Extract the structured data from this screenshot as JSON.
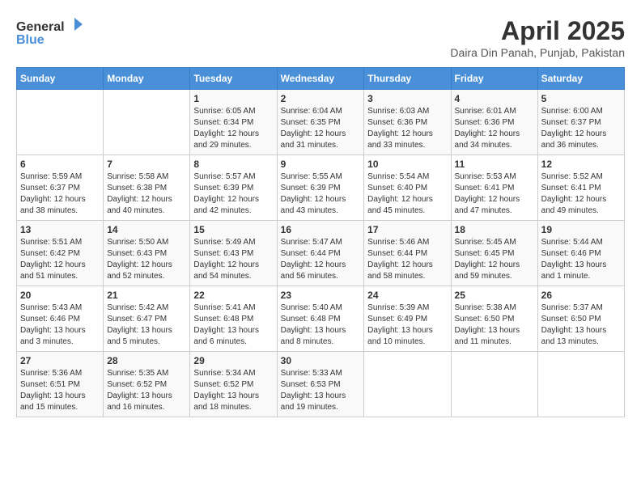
{
  "logo": {
    "general": "General",
    "blue": "Blue"
  },
  "title": "April 2025",
  "subtitle": "Daira Din Panah, Punjab, Pakistan",
  "days_of_week": [
    "Sunday",
    "Monday",
    "Tuesday",
    "Wednesday",
    "Thursday",
    "Friday",
    "Saturday"
  ],
  "weeks": [
    [
      {
        "day": "",
        "info": ""
      },
      {
        "day": "",
        "info": ""
      },
      {
        "day": "1",
        "info": "Sunrise: 6:05 AM\nSunset: 6:34 PM\nDaylight: 12 hours and 29 minutes."
      },
      {
        "day": "2",
        "info": "Sunrise: 6:04 AM\nSunset: 6:35 PM\nDaylight: 12 hours and 31 minutes."
      },
      {
        "day": "3",
        "info": "Sunrise: 6:03 AM\nSunset: 6:36 PM\nDaylight: 12 hours and 33 minutes."
      },
      {
        "day": "4",
        "info": "Sunrise: 6:01 AM\nSunset: 6:36 PM\nDaylight: 12 hours and 34 minutes."
      },
      {
        "day": "5",
        "info": "Sunrise: 6:00 AM\nSunset: 6:37 PM\nDaylight: 12 hours and 36 minutes."
      }
    ],
    [
      {
        "day": "6",
        "info": "Sunrise: 5:59 AM\nSunset: 6:37 PM\nDaylight: 12 hours and 38 minutes."
      },
      {
        "day": "7",
        "info": "Sunrise: 5:58 AM\nSunset: 6:38 PM\nDaylight: 12 hours and 40 minutes."
      },
      {
        "day": "8",
        "info": "Sunrise: 5:57 AM\nSunset: 6:39 PM\nDaylight: 12 hours and 42 minutes."
      },
      {
        "day": "9",
        "info": "Sunrise: 5:55 AM\nSunset: 6:39 PM\nDaylight: 12 hours and 43 minutes."
      },
      {
        "day": "10",
        "info": "Sunrise: 5:54 AM\nSunset: 6:40 PM\nDaylight: 12 hours and 45 minutes."
      },
      {
        "day": "11",
        "info": "Sunrise: 5:53 AM\nSunset: 6:41 PM\nDaylight: 12 hours and 47 minutes."
      },
      {
        "day": "12",
        "info": "Sunrise: 5:52 AM\nSunset: 6:41 PM\nDaylight: 12 hours and 49 minutes."
      }
    ],
    [
      {
        "day": "13",
        "info": "Sunrise: 5:51 AM\nSunset: 6:42 PM\nDaylight: 12 hours and 51 minutes."
      },
      {
        "day": "14",
        "info": "Sunrise: 5:50 AM\nSunset: 6:43 PM\nDaylight: 12 hours and 52 minutes."
      },
      {
        "day": "15",
        "info": "Sunrise: 5:49 AM\nSunset: 6:43 PM\nDaylight: 12 hours and 54 minutes."
      },
      {
        "day": "16",
        "info": "Sunrise: 5:47 AM\nSunset: 6:44 PM\nDaylight: 12 hours and 56 minutes."
      },
      {
        "day": "17",
        "info": "Sunrise: 5:46 AM\nSunset: 6:44 PM\nDaylight: 12 hours and 58 minutes."
      },
      {
        "day": "18",
        "info": "Sunrise: 5:45 AM\nSunset: 6:45 PM\nDaylight: 12 hours and 59 minutes."
      },
      {
        "day": "19",
        "info": "Sunrise: 5:44 AM\nSunset: 6:46 PM\nDaylight: 13 hours and 1 minute."
      }
    ],
    [
      {
        "day": "20",
        "info": "Sunrise: 5:43 AM\nSunset: 6:46 PM\nDaylight: 13 hours and 3 minutes."
      },
      {
        "day": "21",
        "info": "Sunrise: 5:42 AM\nSunset: 6:47 PM\nDaylight: 13 hours and 5 minutes."
      },
      {
        "day": "22",
        "info": "Sunrise: 5:41 AM\nSunset: 6:48 PM\nDaylight: 13 hours and 6 minutes."
      },
      {
        "day": "23",
        "info": "Sunrise: 5:40 AM\nSunset: 6:48 PM\nDaylight: 13 hours and 8 minutes."
      },
      {
        "day": "24",
        "info": "Sunrise: 5:39 AM\nSunset: 6:49 PM\nDaylight: 13 hours and 10 minutes."
      },
      {
        "day": "25",
        "info": "Sunrise: 5:38 AM\nSunset: 6:50 PM\nDaylight: 13 hours and 11 minutes."
      },
      {
        "day": "26",
        "info": "Sunrise: 5:37 AM\nSunset: 6:50 PM\nDaylight: 13 hours and 13 minutes."
      }
    ],
    [
      {
        "day": "27",
        "info": "Sunrise: 5:36 AM\nSunset: 6:51 PM\nDaylight: 13 hours and 15 minutes."
      },
      {
        "day": "28",
        "info": "Sunrise: 5:35 AM\nSunset: 6:52 PM\nDaylight: 13 hours and 16 minutes."
      },
      {
        "day": "29",
        "info": "Sunrise: 5:34 AM\nSunset: 6:52 PM\nDaylight: 13 hours and 18 minutes."
      },
      {
        "day": "30",
        "info": "Sunrise: 5:33 AM\nSunset: 6:53 PM\nDaylight: 13 hours and 19 minutes."
      },
      {
        "day": "",
        "info": ""
      },
      {
        "day": "",
        "info": ""
      },
      {
        "day": "",
        "info": ""
      }
    ]
  ]
}
